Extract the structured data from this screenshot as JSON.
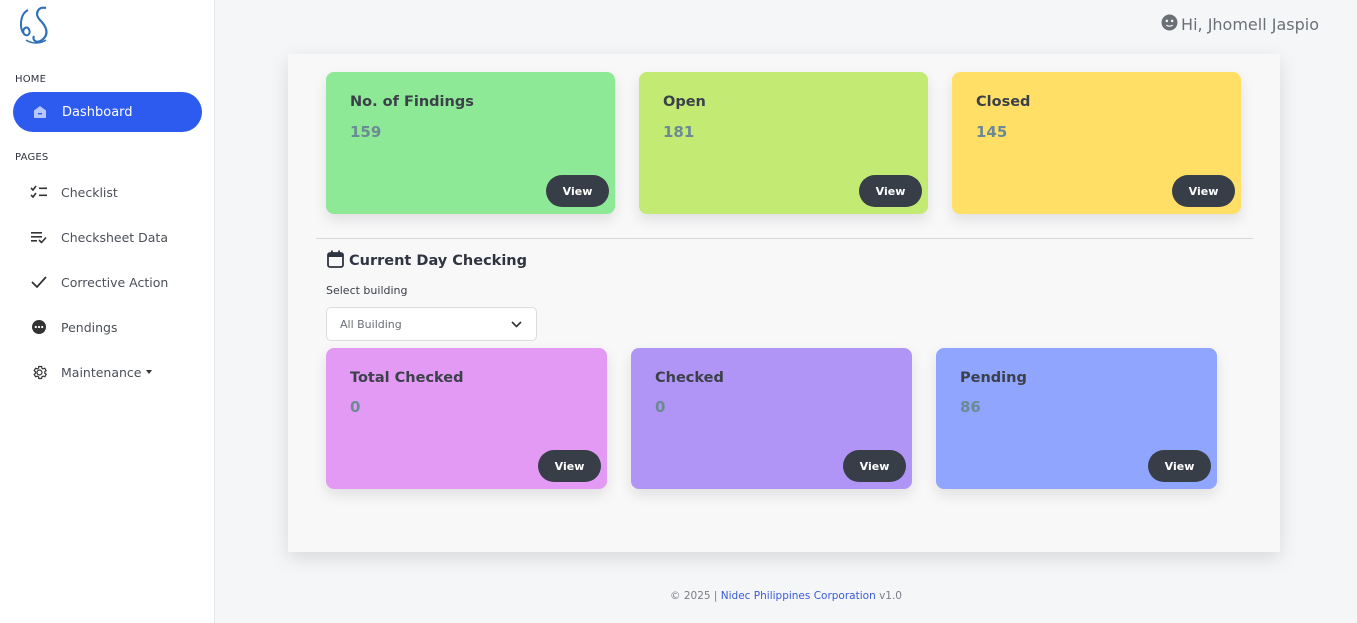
{
  "sidebar": {
    "home_label": "HOME",
    "pages_label": "PAGES",
    "dashboard": "Dashboard",
    "items": [
      {
        "label": "Checklist",
        "icon": "checklist-icon"
      },
      {
        "label": "Checksheet Data",
        "icon": "checksheet-icon"
      },
      {
        "label": "Corrective Action",
        "icon": "check-icon"
      },
      {
        "label": "Pendings",
        "icon": "pending-dots-icon"
      },
      {
        "label": "Maintenance",
        "icon": "gear-icon"
      }
    ]
  },
  "header": {
    "greeting": "Hi, Jhomell Jaspio"
  },
  "summary_cards": [
    {
      "title": "No. of Findings",
      "value": "159",
      "button": "View",
      "color": "#8ee996"
    },
    {
      "title": "Open",
      "value": "181",
      "button": "View",
      "color": "#c3eb74"
    },
    {
      "title": "Closed",
      "value": "145",
      "button": "View",
      "color": "#ffdf66"
    }
  ],
  "current_day": {
    "title": "Current Day Checking",
    "select_label": "Select building",
    "select_value": "All Building"
  },
  "day_cards": [
    {
      "title": "Total Checked",
      "value": "0",
      "button": "View",
      "color": "#e39af5"
    },
    {
      "title": "Checked",
      "value": "0",
      "button": "View",
      "color": "#b095f7"
    },
    {
      "title": "Pending",
      "value": "86",
      "button": "View",
      "color": "#90a5fd"
    }
  ],
  "footer": {
    "copyright": "© 2025 |",
    "company": "Nidec Philippines Corporation",
    "version": "v1.0"
  },
  "colors": {
    "accent": "#2d5bf0",
    "button": "#373e48"
  }
}
